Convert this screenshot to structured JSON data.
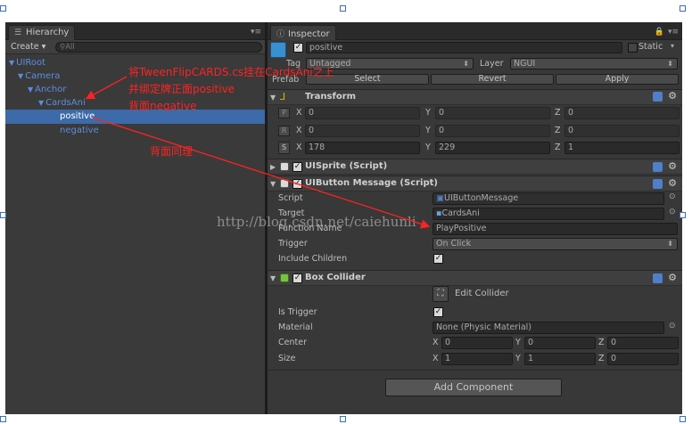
{
  "hierarchy": {
    "tab_label": "Hierarchy",
    "create_label": "Create",
    "search_placeholder": "All",
    "items": [
      {
        "label": "UIRoot",
        "depth": 0
      },
      {
        "label": "Camera",
        "depth": 1
      },
      {
        "label": "Anchor",
        "depth": 2
      },
      {
        "label": "CardsAni",
        "depth": 3
      },
      {
        "label": "positive",
        "depth": 4
      },
      {
        "label": "negative",
        "depth": 4
      }
    ]
  },
  "inspector": {
    "tab_label": "Inspector",
    "object_name": "positive",
    "static_label": "Static",
    "tag_label": "Tag",
    "tag_value": "Untagged",
    "layer_label": "Layer",
    "layer_value": "NGUI",
    "prefab_label": "Prefab",
    "prefab_select": "Select",
    "prefab_revert": "Revert",
    "prefab_apply": "Apply",
    "transform": {
      "title": "Transform",
      "rows": [
        {
          "side": "P",
          "x": "0",
          "y": "0",
          "z": "0"
        },
        {
          "side": "R",
          "x": "0",
          "y": "0",
          "z": "0"
        },
        {
          "side": "S",
          "x": "178",
          "y": "229",
          "z": "1"
        }
      ]
    },
    "uisprite_title": "UISprite (Script)",
    "uibutton": {
      "title": "UIButton Message (Script)",
      "script_label": "Script",
      "script_value": "UIButtonMessage",
      "target_label": "Target",
      "target_value": "CardsAni",
      "function_label": "Function Name",
      "function_value": "PlayPositive",
      "trigger_label": "Trigger",
      "trigger_value": "On Click",
      "include_label": "Include Children"
    },
    "box_collider": {
      "title": "Box Collider",
      "edit_label": "Edit Collider",
      "is_trigger_label": "Is Trigger",
      "material_label": "Material",
      "material_value": "None (Physic Material)",
      "center_label": "Center",
      "center": {
        "x": "0",
        "y": "0",
        "z": "0"
      },
      "size_label": "Size",
      "size": {
        "x": "1",
        "y": "1",
        "z": "0"
      }
    },
    "add_component_label": "Add Component"
  },
  "axis_labels": {
    "x": "X",
    "y": "Y",
    "z": "Z"
  },
  "annotations": {
    "line1": "将TweenFlipCARDS.cs挂在CardsAni之上",
    "line2": "并绑定牌正面positive",
    "line3": "背面negative",
    "line4": "背面同理"
  },
  "watermark": "http://blog.csdn.net/caiehunli",
  "colors": {
    "panel_bg": "#383838",
    "selection": "#3d6aa8",
    "tree_text": "#5a8ee0",
    "annotation": "#ff2222"
  }
}
